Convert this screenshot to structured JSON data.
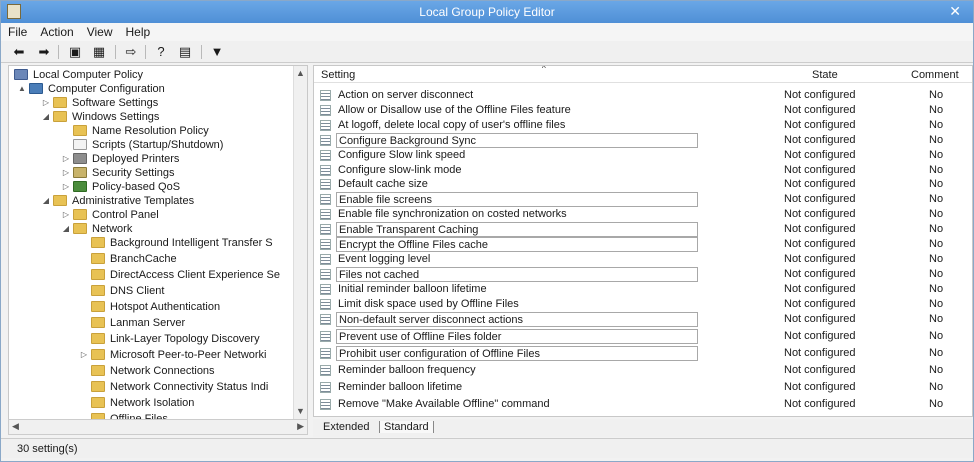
{
  "window": {
    "title": "Local Group Policy Editor"
  },
  "menu": [
    "File",
    "Action",
    "View",
    "Help"
  ],
  "toolbar": [
    {
      "icon": "back-arrow-icon",
      "glyph": "⬅"
    },
    {
      "icon": "forward-arrow-icon",
      "glyph": "➡"
    },
    {
      "icon": "up-folder-icon",
      "glyph": "▣"
    },
    {
      "icon": "show-hide-tree-icon",
      "glyph": "▦"
    },
    {
      "icon": "export-list-icon",
      "glyph": "⇨"
    },
    {
      "icon": "help-icon",
      "glyph": "?"
    },
    {
      "icon": "properties-icon",
      "glyph": "▤"
    },
    {
      "icon": "filter-icon",
      "glyph": "▼"
    }
  ],
  "tree": [
    {
      "label": "Local Computer Policy",
      "indent": 0,
      "icon": "policy",
      "arrow": ""
    },
    {
      "label": "Computer Configuration",
      "indent": 1,
      "icon": "pc",
      "arrow": "▲"
    },
    {
      "label": "Software Settings",
      "indent": 2,
      "icon": "folder",
      "arrow": "▷"
    },
    {
      "label": "Windows Settings",
      "indent": 2,
      "icon": "folder",
      "arrow": "◢"
    },
    {
      "label": "Name Resolution Policy",
      "indent": 3,
      "icon": "folder",
      "arrow": ""
    },
    {
      "label": "Scripts (Startup/Shutdown)",
      "indent": 3,
      "icon": "doc",
      "arrow": ""
    },
    {
      "label": "Deployed Printers",
      "indent": 3,
      "icon": "printer",
      "arrow": "▷"
    },
    {
      "label": "Security Settings",
      "indent": 3,
      "icon": "shield",
      "arrow": "▷"
    },
    {
      "label": "Policy-based QoS",
      "indent": 3,
      "icon": "qos",
      "arrow": "▷"
    },
    {
      "label": "Administrative Templates",
      "indent": 2,
      "icon": "folder",
      "arrow": "◢"
    },
    {
      "label": "Control Panel",
      "indent": 3,
      "icon": "folder",
      "arrow": "▷"
    },
    {
      "label": "Network",
      "indent": 3,
      "icon": "folder",
      "arrow": "◢"
    },
    {
      "label": "Background Intelligent Transfer S",
      "indent": 4,
      "icon": "folder",
      "arrow": ""
    },
    {
      "label": "BranchCache",
      "indent": 4,
      "icon": "folder",
      "arrow": ""
    },
    {
      "label": "DirectAccess Client Experience Se",
      "indent": 4,
      "icon": "folder",
      "arrow": ""
    },
    {
      "label": "DNS Client",
      "indent": 4,
      "icon": "folder",
      "arrow": ""
    },
    {
      "label": "Hotspot Authentication",
      "indent": 4,
      "icon": "folder",
      "arrow": ""
    },
    {
      "label": "Lanman Server",
      "indent": 4,
      "icon": "folder",
      "arrow": ""
    },
    {
      "label": "Link-Layer Topology Discovery",
      "indent": 4,
      "icon": "folder",
      "arrow": ""
    },
    {
      "label": "Microsoft Peer-to-Peer Networki",
      "indent": 4,
      "icon": "folder",
      "arrow": "▷"
    },
    {
      "label": "Network Connections",
      "indent": 4,
      "icon": "folder",
      "arrow": ""
    },
    {
      "label": "Network Connectivity Status Indi",
      "indent": 4,
      "icon": "folder",
      "arrow": ""
    },
    {
      "label": "Network Isolation",
      "indent": 4,
      "icon": "folder",
      "arrow": ""
    },
    {
      "label": "Offline Files",
      "indent": 4,
      "icon": "folder",
      "arrow": ""
    }
  ],
  "columns": {
    "setting": "Setting",
    "state": "State",
    "comment": "Comment"
  },
  "settings": [
    {
      "name": "Action on server disconnect",
      "state": "Not configured",
      "comment": "No",
      "boxed": false
    },
    {
      "name": "Allow or Disallow use of the Offline Files feature",
      "state": "Not configured",
      "comment": "No",
      "boxed": false
    },
    {
      "name": "At logoff, delete local copy of user's offline files",
      "state": "Not configured",
      "comment": "No",
      "boxed": false
    },
    {
      "name": "Configure Background Sync",
      "state": "Not configured",
      "comment": "No",
      "boxed": true
    },
    {
      "name": "Configure Slow link speed",
      "state": "Not configured",
      "comment": "No",
      "boxed": false
    },
    {
      "name": "Configure slow-link mode",
      "state": "Not configured",
      "comment": "No",
      "boxed": false
    },
    {
      "name": "Default cache size",
      "state": "Not configured",
      "comment": "No",
      "boxed": false
    },
    {
      "name": "Enable file screens",
      "state": "Not configured",
      "comment": "No",
      "boxed": true
    },
    {
      "name": "Enable file synchronization on costed networks",
      "state": "Not configured",
      "comment": "No",
      "boxed": false
    },
    {
      "name": "Enable Transparent Caching",
      "state": "Not configured",
      "comment": "No",
      "boxed": true
    },
    {
      "name": "Encrypt the Offline Files cache",
      "state": "Not configured",
      "comment": "No",
      "boxed": true
    },
    {
      "name": "Event logging level",
      "state": "Not configured",
      "comment": "No",
      "boxed": false
    },
    {
      "name": "Files not cached",
      "state": "Not configured",
      "comment": "No",
      "boxed": true
    },
    {
      "name": "Initial reminder balloon lifetime",
      "state": "Not configured",
      "comment": "No",
      "boxed": false
    },
    {
      "name": "Limit disk space used by Offline Files",
      "state": "Not configured",
      "comment": "No",
      "boxed": false
    },
    {
      "name": "Non-default server disconnect actions",
      "state": "Not configured",
      "comment": "No",
      "boxed": true
    },
    {
      "name": "Prevent use of Offline Files folder",
      "state": "Not configured",
      "comment": "No",
      "boxed": true
    },
    {
      "name": "Prohibit user configuration of Offline Files",
      "state": "Not configured",
      "comment": "No",
      "boxed": true
    },
    {
      "name": "Reminder balloon frequency",
      "state": "Not configured",
      "comment": "No",
      "boxed": false
    },
    {
      "name": "Reminder balloon lifetime",
      "state": "Not configured",
      "comment": "No",
      "boxed": false
    },
    {
      "name": "Remove \"Make Available Offline\" command",
      "state": "Not configured",
      "comment": "No",
      "boxed": false
    }
  ],
  "tabs": {
    "extended": "Extended",
    "standard": "Standard"
  },
  "status": "30 setting(s)"
}
